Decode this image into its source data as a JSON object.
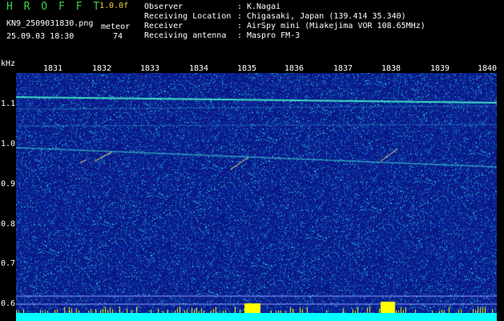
{
  "header": {
    "app_title": "H R O F F T",
    "version": "1.0.0f",
    "filename": "KN9_2509031830.png",
    "method": "meteor",
    "date_time": "25.09.03 18:30",
    "count": "74"
  },
  "meta": [
    {
      "key": "Observer",
      "sep": ":",
      "value": "K.Nagai"
    },
    {
      "key": "Receiving Location",
      "sep": ":",
      "value": "Chigasaki, Japan (139.414 35.340)"
    },
    {
      "key": "Receiver",
      "sep": ":",
      "value": "AirSpy mini (Miakejima VOR 108.65MHz)"
    },
    {
      "key": "Receiving antenna",
      "sep": ":",
      "value": "Maspro FM-3"
    }
  ],
  "axis": {
    "unit": "kHz",
    "y_ticks": [
      "1.1",
      "1.0",
      "0.9",
      "0.8",
      "0.7",
      "0.6"
    ],
    "x_ticks": [
      "1831",
      "1832",
      "1833",
      "1834",
      "1835",
      "1836",
      "1837",
      "1838",
      "1839",
      "1840"
    ]
  },
  "colors": {
    "background": "#000000",
    "waterfall_base": "#0a1a8c",
    "signal": "#33e0d0",
    "bottom_strip": "#00ffff",
    "title_green": "#39d14a",
    "version_yellow": "#e8d14a"
  }
}
